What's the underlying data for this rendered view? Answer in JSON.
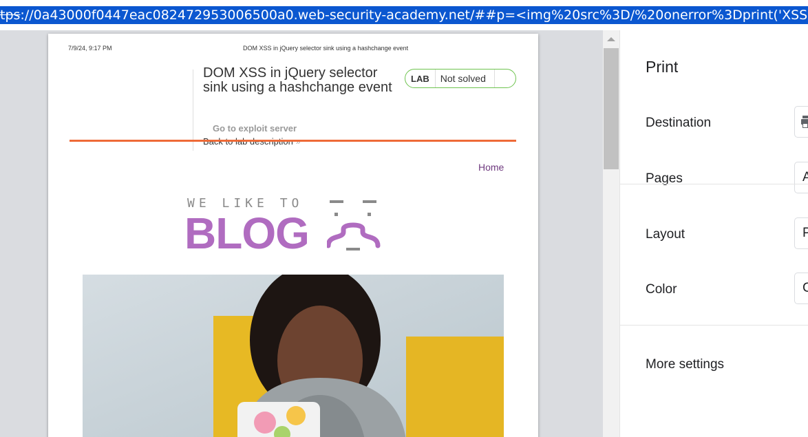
{
  "browser": {
    "url_scheme_fragment": "tps",
    "url_rest": "://0a43000f0447eac082472953006500a0.web-security-academy.net/##p=<img%20src%3D/%20onerror%3Dprint('XSS')>"
  },
  "print_preview": {
    "header_date": "7/9/24, 9:17 PM",
    "header_title": "DOM XSS in jQuery selector sink using a hashchange event",
    "lab": {
      "title": "DOM XSS in jQuery selector sink using a hashchange event",
      "badge_label": "LAB",
      "status": "Not solved",
      "exploit_link": "Go to exploit server",
      "back_link": "Back to lab description",
      "back_chevron": "»"
    },
    "nav": {
      "home": "Home"
    },
    "logo": {
      "tagline": "WE LIKE TO",
      "word": "BLOG"
    }
  },
  "print_panel": {
    "title": "Print",
    "rows": [
      {
        "label": "Destination",
        "value": ""
      },
      {
        "label": "Pages",
        "value": "A"
      },
      {
        "label": "Layout",
        "value": "P"
      },
      {
        "label": "Color",
        "value": "C"
      }
    ],
    "more_settings": "More settings"
  },
  "colors": {
    "accent_orange": "#ee6a37",
    "status_green": "#6dc34e",
    "blog_purple": "#b06cc0",
    "url_selection": "#0b57d0"
  }
}
